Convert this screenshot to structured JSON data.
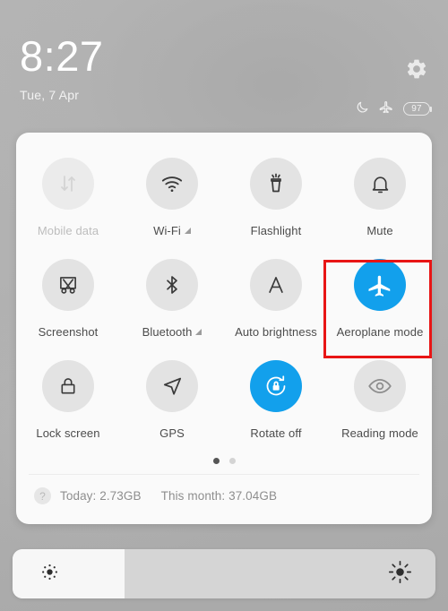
{
  "status_bar": {
    "time": "8:27",
    "date": "Tue, 7 Apr",
    "gear_icon": "gear-icon",
    "icons": [
      {
        "name": "do-not-disturb-moon-icon",
        "glyph": "moon"
      },
      {
        "name": "aeroplane-mode-status-icon",
        "glyph": "airplane"
      }
    ],
    "battery": {
      "level": "97",
      "icon": "battery-icon"
    }
  },
  "quick_settings": {
    "tiles": [
      {
        "label": "Mobile data",
        "icon": "mobile-data-icon",
        "state": "disabled",
        "expandable": false,
        "name": "tile-mobile-data"
      },
      {
        "label": "Wi-Fi",
        "icon": "wifi-icon",
        "state": "off",
        "expandable": true,
        "name": "tile-wifi"
      },
      {
        "label": "Flashlight",
        "icon": "flashlight-icon",
        "state": "off",
        "expandable": false,
        "name": "tile-flashlight"
      },
      {
        "label": "Mute",
        "icon": "bell-icon",
        "state": "off",
        "expandable": false,
        "name": "tile-mute"
      },
      {
        "label": "Screenshot",
        "icon": "screenshot-icon",
        "state": "off",
        "expandable": false,
        "name": "tile-screenshot"
      },
      {
        "label": "Bluetooth",
        "icon": "bluetooth-icon",
        "state": "off",
        "expandable": true,
        "name": "tile-bluetooth"
      },
      {
        "label": "Auto brightness",
        "icon": "auto-brightness-icon",
        "state": "off",
        "expandable": false,
        "name": "tile-auto-brightness"
      },
      {
        "label": "Aeroplane mode",
        "icon": "airplane-icon",
        "state": "on",
        "expandable": false,
        "name": "tile-aeroplane-mode"
      },
      {
        "label": "Lock screen",
        "icon": "lock-icon",
        "state": "off",
        "expandable": false,
        "name": "tile-lock-screen"
      },
      {
        "label": "GPS",
        "icon": "location-arrow-icon",
        "state": "off",
        "expandable": false,
        "name": "tile-gps"
      },
      {
        "label": "Rotate off",
        "icon": "rotation-lock-icon",
        "state": "on",
        "expandable": false,
        "name": "tile-rotate-off"
      },
      {
        "label": "Reading mode",
        "icon": "eye-icon",
        "state": "off",
        "expandable": false,
        "name": "tile-reading-mode"
      }
    ],
    "pages": {
      "count": 2,
      "active_index": 0
    }
  },
  "data_usage": {
    "help_glyph": "?",
    "today": "Today: 2.73GB",
    "month": "This month: 37.04GB"
  },
  "brightness": {
    "fill_percent": "26.5",
    "low_icon": "brightness-low-icon",
    "high_icon": "brightness-high-icon"
  },
  "highlight": {
    "target": "Aeroplane mode",
    "color": "#e81515"
  },
  "colors": {
    "accent_blue": "#12a0ec",
    "panel_bg": "#fafafa",
    "tile_bg": "#e3e3e3",
    "wallpaper": "#b1b1b1",
    "highlight_red": "#e81515"
  }
}
